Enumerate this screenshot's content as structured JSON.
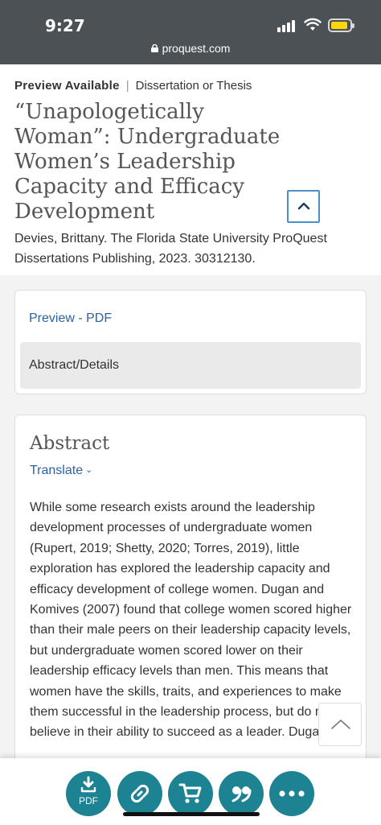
{
  "status": {
    "time": "9:27",
    "url": "proquest.com"
  },
  "document": {
    "availability": "Preview Available",
    "type": "Dissertation or Thesis",
    "title": "“Unapologetically Woman”: Undergraduate Women’s Leadership Capacity and Efficacy Development",
    "authors_line": "Devies, Brittany.   The Florida State University ProQuest Dissertations Publishing,  2023. 30312130."
  },
  "tabs": {
    "preview": "Preview - PDF",
    "abstract_details": "Abstract/Details"
  },
  "abstract": {
    "heading": "Abstract",
    "translate": "Translate",
    "text": "While some research exists around the leadership development processes of undergraduate women (Rupert, 2019; Shetty, 2020; Torres, 2019), little exploration has explored the leadership capacity and efficacy development of college women. Dugan and Komives (2007) found that college women scored higher than their male peers on their leadership capacity levels, but undergraduate women scored lower on their leadership efficacy levels than men. This means that women have the skills, traits, and experiences to make them successful in the leadership process, but do not believe in their ability to succeed as a leader. Dugan"
  },
  "toolbar": {
    "pdf_label": "PDF",
    "accent": "#1d8292"
  },
  "icons": [
    "lock-icon",
    "chevron-up-icon",
    "download-icon",
    "link-icon",
    "cart-icon",
    "quote-icon",
    "more-icon"
  ]
}
